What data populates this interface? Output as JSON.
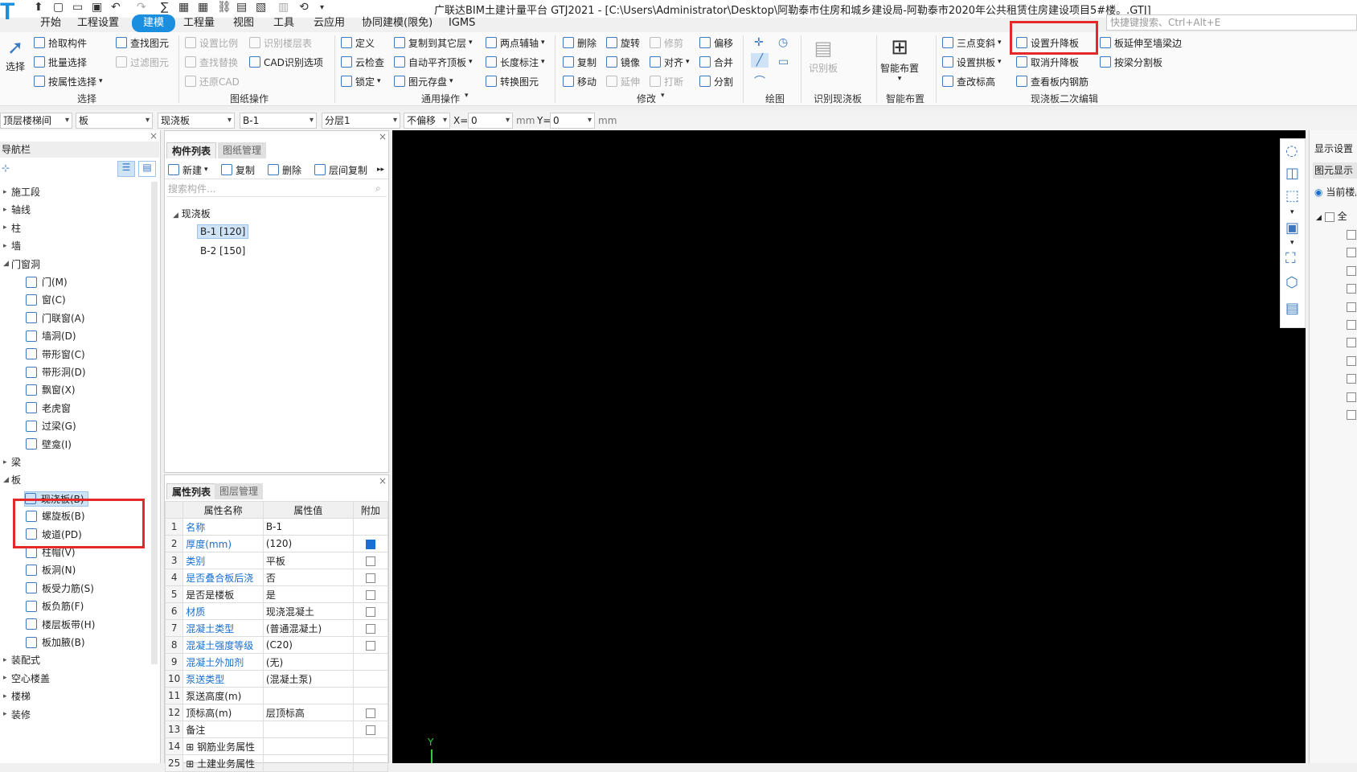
{
  "title": "广联达BIM土建计量平台 GTJ2021 - [C:\\Users\\Administrator\\Desktop\\阿勒泰市住房和城乡建设局-阿勒泰市2020年公共租赁住房建设项目5#楼。.GTJ]",
  "search_placeholder": "快捷键搜索、Ctrl+Alt+E",
  "tabs": [
    "开始",
    "工程设置",
    "建模",
    "工程量",
    "视图",
    "工具",
    "云应用",
    "协同建模(限免)",
    "IGMS"
  ],
  "active_tab": "建模",
  "ribbon": {
    "select": {
      "big": "选择",
      "items": [
        "拾取构件",
        "批量选择",
        "按属性选择",
        "查找图元",
        "过滤图元"
      ],
      "group": "选择"
    },
    "drawing_ops": {
      "items": [
        "设置比例",
        "识别楼层表",
        "查找替换",
        "CAD识别选项",
        "还原CAD"
      ],
      "group": "图纸操作"
    },
    "common_ops": {
      "items": [
        "定义",
        "复制到其它层",
        "两点辅轴",
        "云检查",
        "自动平齐顶板",
        "长度标注",
        "锁定",
        "图元存盘",
        "转换图元"
      ],
      "group": "通用操作"
    },
    "modify": {
      "items": [
        "删除",
        "旋转",
        "修剪",
        "偏移",
        "复制",
        "镜像",
        "对齐",
        "合并",
        "移动",
        "延伸",
        "打断",
        "分割"
      ],
      "group": "修改"
    },
    "draw": {
      "group": "绘图"
    },
    "identify_slab": {
      "big": "识别板",
      "group": "识别现浇板"
    },
    "smart_layout": {
      "big": "智能布置",
      "group": "智能布置"
    },
    "slab_edit": {
      "items": [
        "三点变斜",
        "设置升降板",
        "板延伸至墙梁边",
        "设置拱板",
        "取消升降板",
        "按梁分割板",
        "查改标高",
        "查看板内钢筋"
      ],
      "group": "现浇板二次编辑"
    }
  },
  "propbar": {
    "floor": "顶层楼梯间",
    "category": "板",
    "type": "现浇板",
    "component": "B-1",
    "layer": "分层1",
    "offset": "不偏移",
    "x_label": "X=",
    "x_value": "0",
    "x_unit": "mm",
    "y_label": "Y=",
    "y_value": "0",
    "y_unit": "mm"
  },
  "nav": {
    "title": "导航栏",
    "items": [
      {
        "label": "施工段",
        "level": 0
      },
      {
        "label": "轴线",
        "level": 0
      },
      {
        "label": "柱",
        "level": 0
      },
      {
        "label": "墙",
        "level": 0
      },
      {
        "label": "门窗洞",
        "level": 0,
        "expanded": true
      },
      {
        "label": "门(M)",
        "level": 1
      },
      {
        "label": "窗(C)",
        "level": 1
      },
      {
        "label": "门联窗(A)",
        "level": 1
      },
      {
        "label": "墙洞(D)",
        "level": 1
      },
      {
        "label": "带形窗(C)",
        "level": 1
      },
      {
        "label": "带形洞(D)",
        "level": 1
      },
      {
        "label": "飘窗(X)",
        "level": 1
      },
      {
        "label": "老虎窗",
        "level": 1
      },
      {
        "label": "过梁(G)",
        "level": 1
      },
      {
        "label": "壁龛(I)",
        "level": 1
      },
      {
        "label": "梁",
        "level": 0
      },
      {
        "label": "板",
        "level": 0,
        "expanded": true
      },
      {
        "label": "现浇板(B)",
        "level": 1,
        "selected": true
      },
      {
        "label": "螺旋板(B)",
        "level": 1
      },
      {
        "label": "坡道(PD)",
        "level": 1
      },
      {
        "label": "柱帽(V)",
        "level": 1
      },
      {
        "label": "板洞(N)",
        "level": 1
      },
      {
        "label": "板受力筋(S)",
        "level": 1
      },
      {
        "label": "板负筋(F)",
        "level": 1
      },
      {
        "label": "楼层板带(H)",
        "level": 1
      },
      {
        "label": "板加腋(B)",
        "level": 1
      },
      {
        "label": "装配式",
        "level": 0
      },
      {
        "label": "空心楼盖",
        "level": 0
      },
      {
        "label": "楼梯",
        "level": 0
      },
      {
        "label": "装修",
        "level": 0
      }
    ]
  },
  "complist": {
    "tab_active": "构件列表",
    "tab_other": "图纸管理",
    "toolbar": [
      "新建",
      "复制",
      "删除",
      "层间复制"
    ],
    "search_placeholder": "搜索构件...",
    "root": "现浇板",
    "items": [
      "B-1 [120]",
      "B-2 [150]"
    ]
  },
  "proplist": {
    "tab_active": "属性列表",
    "tab_other": "图层管理",
    "headers": [
      "属性名称",
      "属性值",
      "附加"
    ],
    "rows": [
      {
        "n": "1",
        "name": "名称",
        "value": "B-1",
        "link": true,
        "cb": "none"
      },
      {
        "n": "2",
        "name": "厚度(mm)",
        "value": "(120)",
        "link": true,
        "cb": "on"
      },
      {
        "n": "3",
        "name": "类别",
        "value": "平板",
        "link": true,
        "cb": "off"
      },
      {
        "n": "4",
        "name": "是否叠合板后浇",
        "value": "否",
        "link": true,
        "cb": "off"
      },
      {
        "n": "5",
        "name": "是否是楼板",
        "value": "是",
        "link": false,
        "cb": "off"
      },
      {
        "n": "6",
        "name": "材质",
        "value": "现浇混凝土",
        "link": true,
        "cb": "off"
      },
      {
        "n": "7",
        "name": "混凝土类型",
        "value": "(普通混凝土)",
        "link": true,
        "cb": "off"
      },
      {
        "n": "8",
        "name": "混凝土强度等级",
        "value": "(C20)",
        "link": true,
        "cb": "off"
      },
      {
        "n": "9",
        "name": "混凝土外加剂",
        "value": "(无)",
        "link": true,
        "cb": "none"
      },
      {
        "n": "10",
        "name": "泵送类型",
        "value": "(混凝土泵)",
        "link": true,
        "cb": "none"
      },
      {
        "n": "11",
        "name": "泵送高度(m)",
        "value": "",
        "link": false,
        "cb": "none"
      },
      {
        "n": "12",
        "name": "顶标高(m)",
        "value": "层顶标高",
        "link": false,
        "cb": "off"
      },
      {
        "n": "13",
        "name": "备注",
        "value": "",
        "link": false,
        "cb": "off"
      },
      {
        "n": "14",
        "name": "钢筋业务属性",
        "value": "",
        "link": false,
        "cb": "none",
        "plus": true
      },
      {
        "n": "25",
        "name": "土建业务属性",
        "value": "",
        "link": false,
        "cb": "none",
        "plus": true
      }
    ]
  },
  "right_panel": {
    "title": "显示设置",
    "tab": "图元显示",
    "radio": "当前楼层",
    "all": "全"
  },
  "canvas_axis": "Y",
  "colors": {
    "accent": "#1a8fe0",
    "highlight": "#e52929",
    "canvas": "#000000"
  }
}
